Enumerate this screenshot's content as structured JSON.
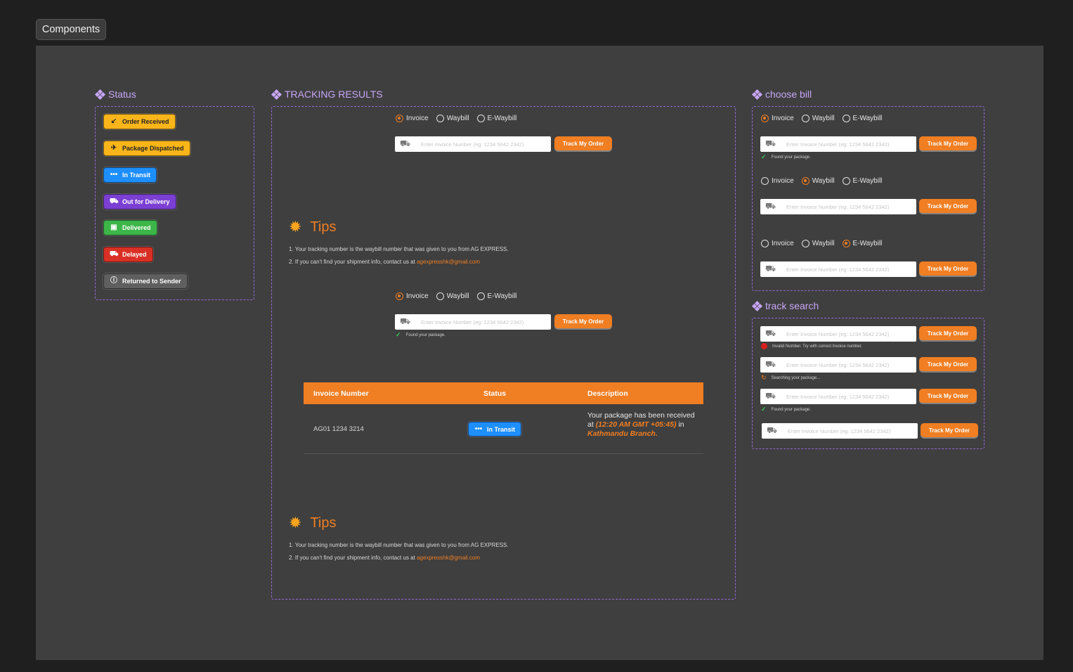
{
  "page_tab": "Components",
  "colors": {
    "accent": "#f07e22",
    "section_title": "#c7a6f5",
    "frame_border": "#8f6ad6"
  },
  "status_section": {
    "title": "Status",
    "badges": [
      {
        "label": "Order Received",
        "icon": "arrow-down-left-icon",
        "color": "#f9b51a",
        "text_color": "#222"
      },
      {
        "label": "Package Dispatched",
        "icon": "plane-departure-icon",
        "color": "#f9b51a",
        "text_color": "#222"
      },
      {
        "label": "In Transit",
        "icon": "dots-icon",
        "color": "#1e8fff",
        "text_color": "#fff"
      },
      {
        "label": "Out for Delivery",
        "icon": "truck-icon",
        "color": "#7b3fd3",
        "text_color": "#fff"
      },
      {
        "label": "Delivered",
        "icon": "package-icon",
        "color": "#3db649",
        "text_color": "#fff"
      },
      {
        "label": "Delayed",
        "icon": "truck-clock-icon",
        "color": "#d93025",
        "text_color": "#fff"
      },
      {
        "label": "Returned to Sender",
        "icon": "info-icon",
        "color": "#5f5f5f",
        "text_color": "#fff"
      }
    ]
  },
  "tracking_section": {
    "title": "TRACKING RESULTS",
    "radio_options": [
      "Invoice",
      "Waybill",
      "E-Waybill"
    ],
    "input_placeholder": "Enter Invoice Number (eg: 1234 5642 2342)",
    "track_button": "Track My Order",
    "found_text": "Found your package.",
    "tips": {
      "heading": "Tips",
      "line1": "1. Your tracking number is the waybill number that was given to you from AG EXPRESS.",
      "line2_prefix": "2. If you can't find your shipment info, contact us at",
      "email": "agexpresshk@gmail.com"
    },
    "table": {
      "headers": [
        "Invoice Number",
        "Status",
        "Description"
      ],
      "row": {
        "invoice": "AG01 1234 3214",
        "status": "In Transit",
        "desc_prefix": "Your package has been received at",
        "desc_time": "(12:20 AM GMT +05:45)",
        "desc_mid": "in",
        "desc_place": "Kathmandu Branch."
      }
    }
  },
  "choose_bill": {
    "title": "choose bill",
    "radio_options": [
      "Invoice",
      "Waybill",
      "E-Waybill"
    ],
    "input_placeholder": "Enter Invoice Number (eg: 1234 5642 2342)",
    "track_button": "Track My Order",
    "found_text": "Found your package."
  },
  "track_search": {
    "title": "track search",
    "input_placeholder": "Enter Invoice Number (eg: 1234 5642 2342)",
    "track_button": "Track My Order",
    "invalid_text": "Invalid Number. Try with correct Invoice number.",
    "searching_text": "Searching your package...",
    "found_text": "Found your package."
  }
}
